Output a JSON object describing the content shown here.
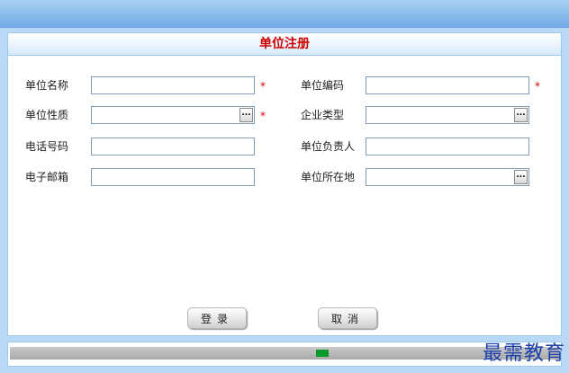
{
  "form": {
    "title": "单位注册",
    "fields": {
      "unit_name": {
        "label": "单位名称",
        "value": "",
        "required_mark": "*"
      },
      "unit_code": {
        "label": "单位编码",
        "value": "",
        "required_mark": "*"
      },
      "unit_nature": {
        "label": "单位性质",
        "value": "",
        "required_mark": "*",
        "picker_label": "..."
      },
      "enterprise_type": {
        "label": "企业类型",
        "value": "",
        "picker_label": "..."
      },
      "phone": {
        "label": "电话号码",
        "value": ""
      },
      "unit_leader": {
        "label": "单位负责人",
        "value": ""
      },
      "email": {
        "label": "电子邮箱",
        "value": ""
      },
      "unit_location": {
        "label": "单位所在地",
        "value": "",
        "picker_label": "..."
      }
    },
    "buttons": {
      "login_label": "登录",
      "cancel_label": "取消"
    }
  },
  "colors": {
    "title_red": "#cc0000",
    "required_red": "#e00000",
    "frame_blue": "#b8d8f6",
    "progress_green": "#0a9a2a"
  },
  "watermark": "最需教育"
}
